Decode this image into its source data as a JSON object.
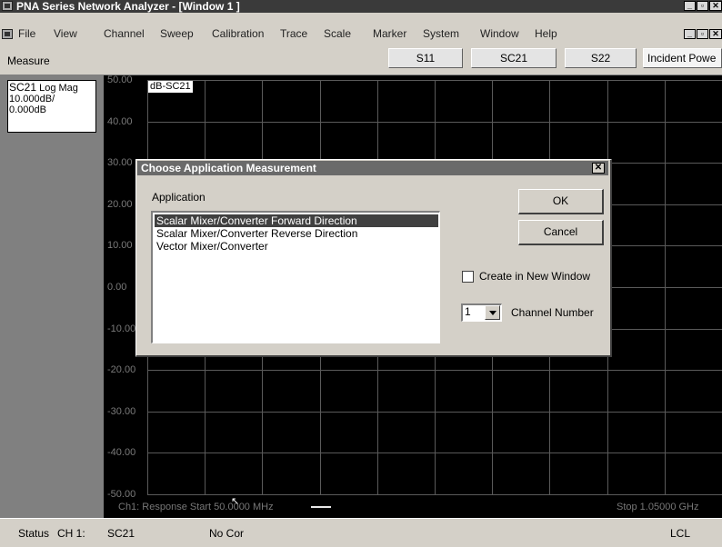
{
  "window": {
    "title": "PNA Series Network Analyzer - [Window 1 ]",
    "min_glyph": "_",
    "max_glyph": "▫",
    "close_glyph": "✕"
  },
  "menu": [
    "File",
    "View",
    "Channel",
    "Sweep",
    "Calibration",
    "Trace",
    "Scale",
    "Marker",
    "System",
    "Window",
    "Help"
  ],
  "toolbar": {
    "measure_label": "Measure",
    "buttons": [
      "S11",
      "SC21",
      "S22",
      "Incident Powe"
    ]
  },
  "trace_panel": {
    "name": "SC21",
    "format": "Log Mag",
    "scale": "10.000dB/",
    "ref": "0.000dB"
  },
  "graph": {
    "trace_tag": "dB-SC21",
    "y_labels": [
      "50.00",
      "40.00",
      "30.00",
      "20.00",
      "10.00",
      "0.00",
      "-10.00",
      "-20.00",
      "-30.00",
      "-40.00",
      "-50.00"
    ],
    "start_text": "Ch1: Response Start  50.0000 MHz",
    "stop_text": "Stop  1.05000 GHz"
  },
  "dialog": {
    "title": "Choose Application Measurement",
    "close_glyph": "✕",
    "application_label": "Application",
    "applications": [
      "Scalar Mixer/Converter Forward Direction",
      "Scalar Mixer/Converter Reverse Direction",
      "Vector Mixer/Converter"
    ],
    "selected_index": 0,
    "ok_label": "OK",
    "cancel_label": "Cancel",
    "create_new_window_label": "Create in New Window",
    "create_new_window_checked": false,
    "channel_number_value": "1",
    "channel_number_label": "Channel Number"
  },
  "statusbar": {
    "status": "Status",
    "channel": "CH 1:",
    "measurement": "SC21",
    "correction": "No Cor",
    "mode": "LCL"
  },
  "colors": {
    "titlebar": "#3a3a3a",
    "graph_bg": "#000000",
    "grid": "#5a5a5a",
    "selection": "#404040",
    "chrome": "#d4d0c8"
  }
}
